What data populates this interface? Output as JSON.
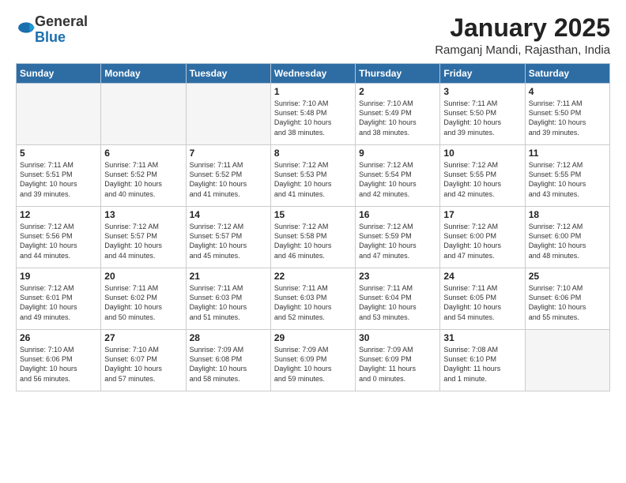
{
  "header": {
    "logo_general": "General",
    "logo_blue": "Blue",
    "month_title": "January 2025",
    "location": "Ramganj Mandi, Rajasthan, India"
  },
  "weekdays": [
    "Sunday",
    "Monday",
    "Tuesday",
    "Wednesday",
    "Thursday",
    "Friday",
    "Saturday"
  ],
  "weeks": [
    [
      {
        "day": "",
        "content": ""
      },
      {
        "day": "",
        "content": ""
      },
      {
        "day": "",
        "content": ""
      },
      {
        "day": "1",
        "content": "Sunrise: 7:10 AM\nSunset: 5:48 PM\nDaylight: 10 hours\nand 38 minutes."
      },
      {
        "day": "2",
        "content": "Sunrise: 7:10 AM\nSunset: 5:49 PM\nDaylight: 10 hours\nand 38 minutes."
      },
      {
        "day": "3",
        "content": "Sunrise: 7:11 AM\nSunset: 5:50 PM\nDaylight: 10 hours\nand 39 minutes."
      },
      {
        "day": "4",
        "content": "Sunrise: 7:11 AM\nSunset: 5:50 PM\nDaylight: 10 hours\nand 39 minutes."
      }
    ],
    [
      {
        "day": "5",
        "content": "Sunrise: 7:11 AM\nSunset: 5:51 PM\nDaylight: 10 hours\nand 39 minutes."
      },
      {
        "day": "6",
        "content": "Sunrise: 7:11 AM\nSunset: 5:52 PM\nDaylight: 10 hours\nand 40 minutes."
      },
      {
        "day": "7",
        "content": "Sunrise: 7:11 AM\nSunset: 5:52 PM\nDaylight: 10 hours\nand 41 minutes."
      },
      {
        "day": "8",
        "content": "Sunrise: 7:12 AM\nSunset: 5:53 PM\nDaylight: 10 hours\nand 41 minutes."
      },
      {
        "day": "9",
        "content": "Sunrise: 7:12 AM\nSunset: 5:54 PM\nDaylight: 10 hours\nand 42 minutes."
      },
      {
        "day": "10",
        "content": "Sunrise: 7:12 AM\nSunset: 5:55 PM\nDaylight: 10 hours\nand 42 minutes."
      },
      {
        "day": "11",
        "content": "Sunrise: 7:12 AM\nSunset: 5:55 PM\nDaylight: 10 hours\nand 43 minutes."
      }
    ],
    [
      {
        "day": "12",
        "content": "Sunrise: 7:12 AM\nSunset: 5:56 PM\nDaylight: 10 hours\nand 44 minutes."
      },
      {
        "day": "13",
        "content": "Sunrise: 7:12 AM\nSunset: 5:57 PM\nDaylight: 10 hours\nand 44 minutes."
      },
      {
        "day": "14",
        "content": "Sunrise: 7:12 AM\nSunset: 5:57 PM\nDaylight: 10 hours\nand 45 minutes."
      },
      {
        "day": "15",
        "content": "Sunrise: 7:12 AM\nSunset: 5:58 PM\nDaylight: 10 hours\nand 46 minutes."
      },
      {
        "day": "16",
        "content": "Sunrise: 7:12 AM\nSunset: 5:59 PM\nDaylight: 10 hours\nand 47 minutes."
      },
      {
        "day": "17",
        "content": "Sunrise: 7:12 AM\nSunset: 6:00 PM\nDaylight: 10 hours\nand 47 minutes."
      },
      {
        "day": "18",
        "content": "Sunrise: 7:12 AM\nSunset: 6:00 PM\nDaylight: 10 hours\nand 48 minutes."
      }
    ],
    [
      {
        "day": "19",
        "content": "Sunrise: 7:12 AM\nSunset: 6:01 PM\nDaylight: 10 hours\nand 49 minutes."
      },
      {
        "day": "20",
        "content": "Sunrise: 7:11 AM\nSunset: 6:02 PM\nDaylight: 10 hours\nand 50 minutes."
      },
      {
        "day": "21",
        "content": "Sunrise: 7:11 AM\nSunset: 6:03 PM\nDaylight: 10 hours\nand 51 minutes."
      },
      {
        "day": "22",
        "content": "Sunrise: 7:11 AM\nSunset: 6:03 PM\nDaylight: 10 hours\nand 52 minutes."
      },
      {
        "day": "23",
        "content": "Sunrise: 7:11 AM\nSunset: 6:04 PM\nDaylight: 10 hours\nand 53 minutes."
      },
      {
        "day": "24",
        "content": "Sunrise: 7:11 AM\nSunset: 6:05 PM\nDaylight: 10 hours\nand 54 minutes."
      },
      {
        "day": "25",
        "content": "Sunrise: 7:10 AM\nSunset: 6:06 PM\nDaylight: 10 hours\nand 55 minutes."
      }
    ],
    [
      {
        "day": "26",
        "content": "Sunrise: 7:10 AM\nSunset: 6:06 PM\nDaylight: 10 hours\nand 56 minutes."
      },
      {
        "day": "27",
        "content": "Sunrise: 7:10 AM\nSunset: 6:07 PM\nDaylight: 10 hours\nand 57 minutes."
      },
      {
        "day": "28",
        "content": "Sunrise: 7:09 AM\nSunset: 6:08 PM\nDaylight: 10 hours\nand 58 minutes."
      },
      {
        "day": "29",
        "content": "Sunrise: 7:09 AM\nSunset: 6:09 PM\nDaylight: 10 hours\nand 59 minutes."
      },
      {
        "day": "30",
        "content": "Sunrise: 7:09 AM\nSunset: 6:09 PM\nDaylight: 11 hours\nand 0 minutes."
      },
      {
        "day": "31",
        "content": "Sunrise: 7:08 AM\nSunset: 6:10 PM\nDaylight: 11 hours\nand 1 minute."
      },
      {
        "day": "",
        "content": ""
      }
    ]
  ]
}
